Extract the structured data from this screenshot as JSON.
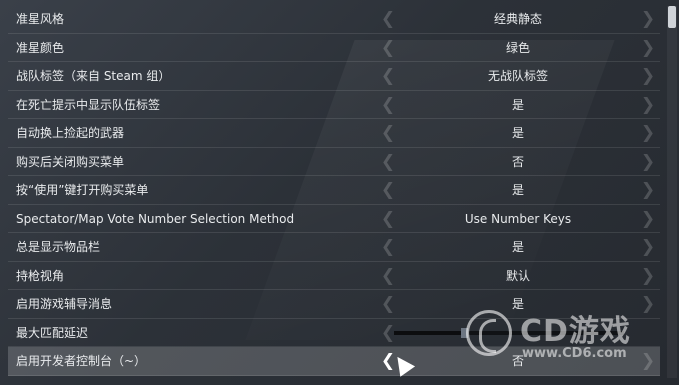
{
  "settings": [
    {
      "label": "准星风格",
      "value": "经典静态"
    },
    {
      "label": "准星颜色",
      "value": "绿色"
    },
    {
      "label": "战队标签（来自 Steam 组）",
      "value": "无战队标签"
    },
    {
      "label": "在死亡提示中显示队伍标签",
      "value": "是"
    },
    {
      "label": "自动换上捡起的武器",
      "value": "是"
    },
    {
      "label": "购买后关闭购买菜单",
      "value": "否"
    },
    {
      "label": "按“使用”键打开购买菜单",
      "value": "是"
    },
    {
      "label": "Spectator/Map Vote Number Selection Method",
      "value": "Use Number Keys"
    },
    {
      "label": "总是显示物品栏",
      "value": "是"
    },
    {
      "label": "持枪视角",
      "value": "默认"
    },
    {
      "label": "启用游戏辅导消息",
      "value": "是"
    },
    {
      "label": "最大匹配延迟",
      "value": ""
    },
    {
      "label": "启用开发者控制台（~）",
      "value": "否"
    }
  ],
  "slider_value": 0.3,
  "arrows": {
    "left": "❮",
    "right": "❯"
  },
  "watermark": {
    "brand": "CD游戏",
    "url": "www.CD6.com"
  },
  "colors": {
    "background": "#2c3138",
    "highlight_row": "#5a5f66",
    "text": "#e9ebed"
  }
}
